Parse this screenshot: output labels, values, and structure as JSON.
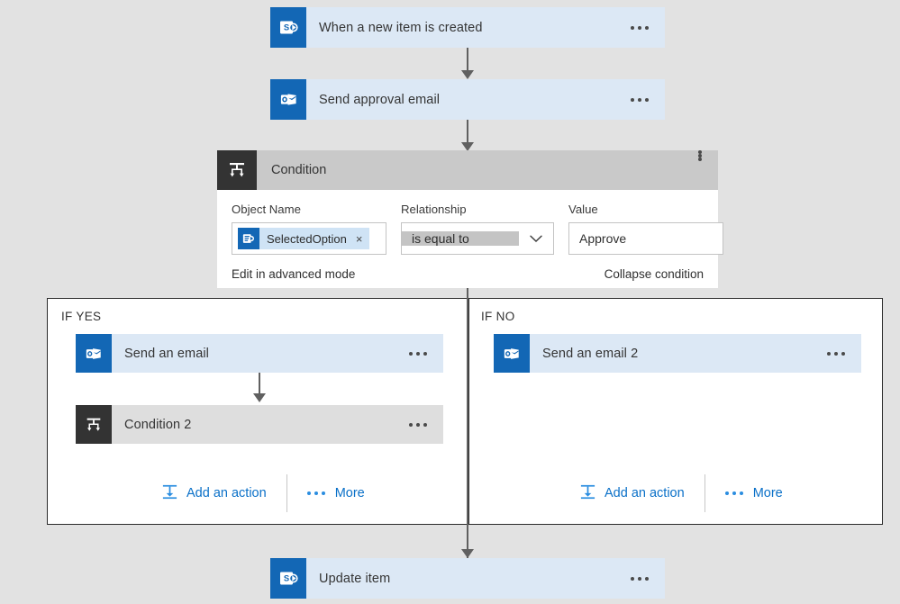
{
  "flow": {
    "trigger": {
      "title": "When a new item is created",
      "icon": "sharepoint-icon",
      "menu": "more-options"
    },
    "approval_step": {
      "title": "Send approval email",
      "icon": "outlook-icon",
      "menu": "more-options"
    },
    "condition": {
      "title": "Condition",
      "icon": "condition-icon",
      "menu": "more-options",
      "fields": {
        "object_name": {
          "label": "Object Name",
          "token": "SelectedOption",
          "token_icon": "sharepoint-token-icon",
          "remove": "×"
        },
        "relationship": {
          "label": "Relationship",
          "value": "is equal to",
          "caret": "chevron-down-icon"
        },
        "value": {
          "label": "Value",
          "value": "Approve"
        }
      },
      "footer": {
        "advanced": "Edit in advanced mode",
        "collapse": "Collapse condition"
      }
    },
    "branches": [
      {
        "label": "IF YES",
        "cards": [
          {
            "title": "Send an email",
            "icon": "outlook-icon",
            "style": "blue"
          },
          {
            "title": "Condition 2",
            "icon": "condition-icon",
            "style": "gray"
          }
        ],
        "add_action": "Add an action",
        "more": "More"
      },
      {
        "label": "IF NO",
        "cards": [
          {
            "title": "Send an email 2",
            "icon": "outlook-icon",
            "style": "blue"
          }
        ],
        "add_action": "Add an action",
        "more": "More"
      }
    ],
    "final_step": {
      "title": "Update item",
      "icon": "sharepoint-icon",
      "menu": "more-options"
    }
  },
  "colors": {
    "canvas_bg": "#e2e2e2",
    "card_blue": "#dce8f5",
    "card_blue_icon": "#1367b5",
    "card_gray": "#dedede",
    "card_gray_icon": "#333333",
    "condition_header": "#c9c9c9",
    "link_blue": "#0a70c8",
    "connector": "#606060"
  }
}
